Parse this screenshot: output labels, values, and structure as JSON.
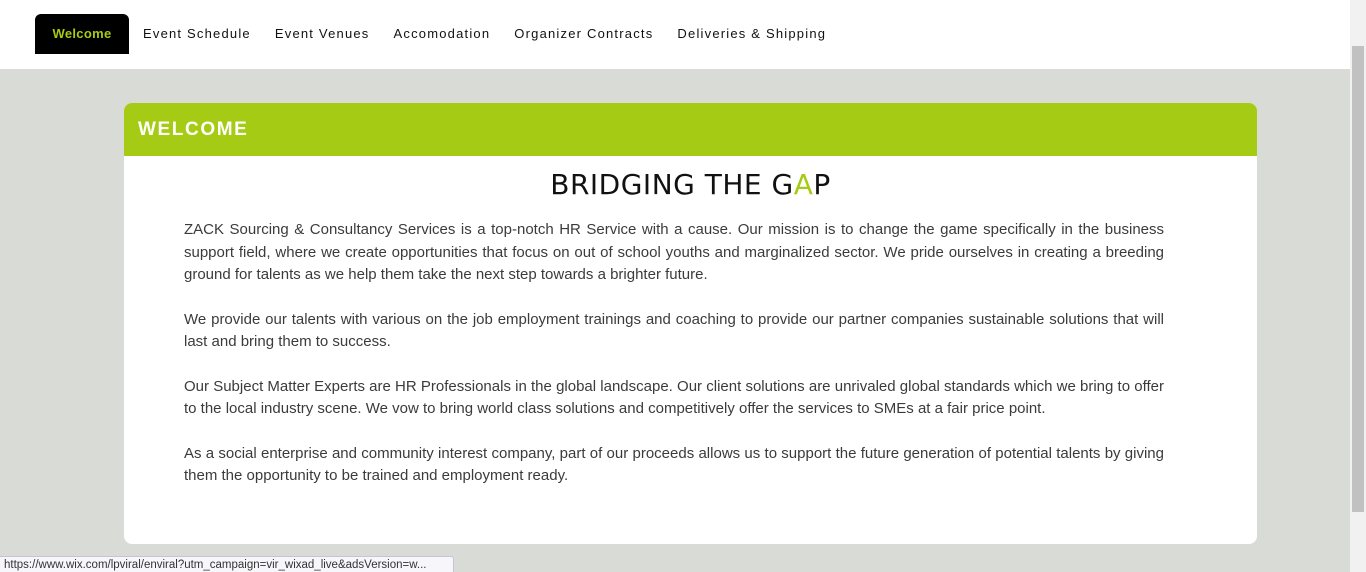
{
  "nav": {
    "items": [
      {
        "label": "Welcome",
        "active": true
      },
      {
        "label": "Event Schedule"
      },
      {
        "label": "Event Venues"
      },
      {
        "label": "Accomodation"
      },
      {
        "label": "Organizer Contracts"
      },
      {
        "label": "Deliveries & Shipping"
      }
    ]
  },
  "card": {
    "header_title": "WELCOME",
    "headline_part1": "BRIDGING THE G",
    "headline_accent": "A",
    "headline_part2": "P",
    "paragraphs": [
      "ZACK Sourcing & Consultancy Services is a top-notch HR Service with a cause. Our mission is to change the game specifically in the business support field, where we create opportunities that focus on out of school youths and marginalized sector. We pride ourselves in creating a breeding ground for talents as we help them take the next step towards a brighter future.",
      "We provide our talents with various on the job employment trainings and coaching to provide our partner companies sustainable solutions that will last and bring them to success.",
      "Our Subject Matter Experts are HR Professionals in the global landscape. Our client solutions are unrivaled global standards which we bring to offer to the local industry scene. We vow to bring world class solutions and competitively offer the services to SMEs at a fair price point.",
      "As a social enterprise and community interest company, part of our proceeds allows us to support the future generation of potential talents by giving them the opportunity to be trained and employment ready."
    ]
  },
  "statusbar": {
    "url": "https://www.wix.com/lpviral/enviral?utm_campaign=vir_wixad_live&adsVersion=w..."
  },
  "colors": {
    "accent": "#a6cb14",
    "nav_active_bg": "#000000",
    "page_bg": "#d9dbd6"
  }
}
